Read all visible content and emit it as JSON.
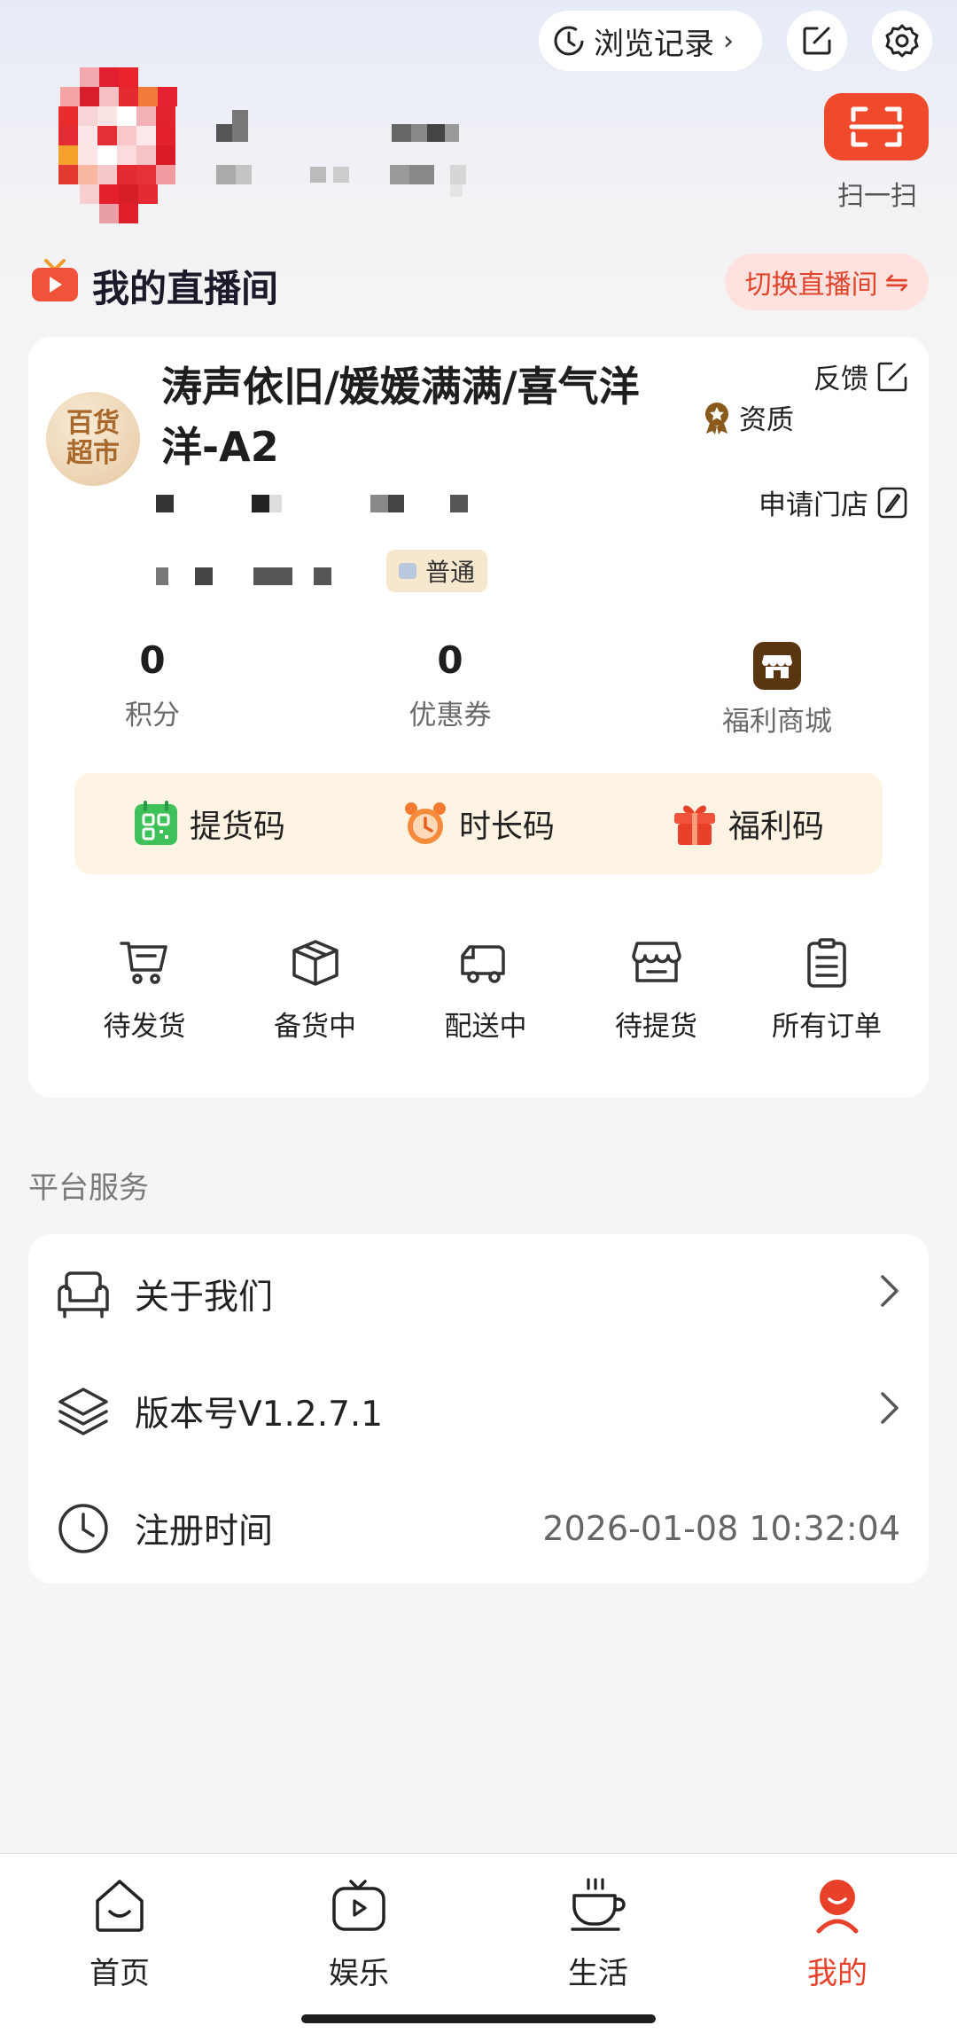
{
  "header": {
    "history_label": "浏览记录",
    "scan_label": "扫一扫"
  },
  "live_room": {
    "title": "我的直播间",
    "switch_label": "切换直播间"
  },
  "store": {
    "logo_line1": "百货",
    "logo_line2": "超市",
    "name": "涛声依旧/媛媛满满/喜气洋洋-A2",
    "feedback_label": "反馈",
    "qualification_label": "资质",
    "apply_store_label": "申请门店",
    "level_label": "普通"
  },
  "stats": {
    "points_value": "0",
    "points_label": "积分",
    "coupons_value": "0",
    "coupons_label": "优惠券",
    "mall_label": "福利商城"
  },
  "codes": [
    {
      "label": "提货码",
      "icon": "qr-code-icon"
    },
    {
      "label": "时长码",
      "icon": "alarm-clock-icon"
    },
    {
      "label": "福利码",
      "icon": "gift-icon"
    }
  ],
  "orders": [
    {
      "label": "待发货",
      "icon": "cart-icon"
    },
    {
      "label": "备货中",
      "icon": "box-icon"
    },
    {
      "label": "配送中",
      "icon": "truck-icon"
    },
    {
      "label": "待提货",
      "icon": "store-icon"
    },
    {
      "label": "所有订单",
      "icon": "clipboard-icon"
    }
  ],
  "services": {
    "section_title": "平台服务",
    "about_label": "关于我们",
    "version_label": "版本号V1.2.7.1",
    "register_label": "注册时间",
    "register_time": "2026-01-08 10:32:04"
  },
  "nav": [
    {
      "label": "首页",
      "icon": "home-icon"
    },
    {
      "label": "娱乐",
      "icon": "tv-icon"
    },
    {
      "label": "生活",
      "icon": "coffee-cup-icon"
    },
    {
      "label": "我的",
      "icon": "profile-icon"
    }
  ],
  "colors": {
    "accent": "#e8412a",
    "scan": "#ee4a2b",
    "code_bar_bg": "#fff4e3"
  }
}
